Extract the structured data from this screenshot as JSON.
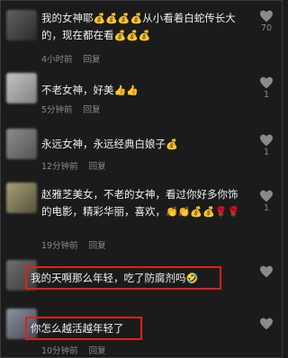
{
  "comments": [
    {
      "text": "我的女神耶",
      "emoji_mid": "💰💰💰💰",
      "text_after": "从小看着白蛇传长大的，现在都在看",
      "emoji_end": "💰💰💰",
      "time": "4小时前",
      "reply": "回复",
      "likes": "70"
    },
    {
      "text": "不老女神，好美",
      "emoji_end": "👍👍",
      "time": "5分钟前",
      "reply": "回复",
      "likes": "1"
    },
    {
      "text": "永远女神，永远经典白娘子",
      "emoji_end": "💰",
      "time": "12分钟前",
      "reply": "回复",
      "likes": "1"
    },
    {
      "text": "赵雅芝美女，不老的女神，看过你好多你饰的电影，精彩华丽，喜欢，",
      "emoji_end": "👏👏💰💰🌹🌹",
      "time": "19分钟前",
      "reply": "回复",
      "likes": "1"
    },
    {
      "text": "我的天啊那么年轻，吃了防腐剂吗",
      "emoji_end": "🤣",
      "time": "",
      "reply": "",
      "likes": ""
    },
    {
      "text": "你怎么越活越年轻了",
      "emoji_end": "",
      "time": "10分钟前",
      "reply": "回复",
      "likes": ""
    }
  ],
  "colors": {
    "background": "#1b1b1b",
    "highlight": "#e51d1d",
    "meta": "#8a8a8a"
  },
  "icons": {
    "like": "heart-icon"
  }
}
